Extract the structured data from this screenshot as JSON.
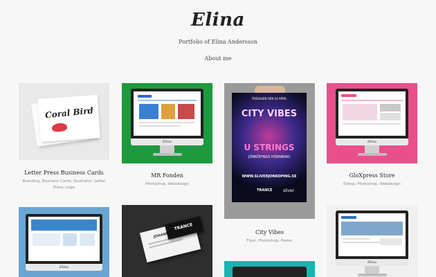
{
  "site": {
    "logo": "Elina",
    "subtitle": "Portfolio of Elina Andersson",
    "nav": {
      "about": "About me"
    }
  },
  "portfolio": [
    {
      "title": "Letter Press Business Cards",
      "tags": "Branding, Business Cards, Illustrator, Letter Press, Logo",
      "thumb_text": "Coral Bird"
    },
    {
      "title": "MR Fonden",
      "tags": "Photoshop, Webdesign",
      "monitor_label": "Elina"
    },
    {
      "title": "City Vibes",
      "tags": "Flyer, Photoshop, Poster",
      "poster": {
        "top": "FREDAGEN DEN 16 APRIL",
        "headline": "CITY VIBES",
        "band": "U STRINGS",
        "venue": "JÖNKÖPINGS HÖRNBIAD",
        "url": "WWW.SLIVERJONKOPING.SE",
        "sponsor1": "TRANCE",
        "sponsor2": "sliver"
      }
    },
    {
      "title": "GloXpress Store",
      "tags": "Eshop, Photoshop, Webdesign",
      "monitor_label": "Elina"
    },
    {
      "title": "",
      "tags": "",
      "monitor_label": "Elina"
    },
    {
      "title": "",
      "tags": "",
      "card_brand": "TRANCE",
      "card_name": "JOHANNA HA..."
    },
    {
      "title": "",
      "tags": ""
    },
    {
      "title": "",
      "tags": "",
      "monitor_label": "Elina"
    }
  ],
  "colors": {
    "background": "#f7f7f7",
    "mr_fonden_bg": "#1e9a3c",
    "glo_bg": "#e8508c",
    "city_poster_bg": "#0b0b1e",
    "card5_bg": "#6aa6d4",
    "card7_bg": "#19b3b0"
  }
}
